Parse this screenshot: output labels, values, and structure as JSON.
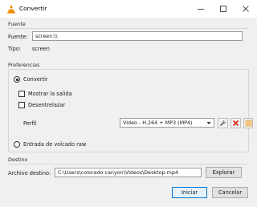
{
  "window": {
    "title": "Convertir",
    "app_icon": "vlc-cone-icon",
    "controls": [
      "minimize-icon",
      "maximize-icon",
      "close-icon"
    ]
  },
  "source": {
    "group_label": "Fuente",
    "field_label": "Fuente:",
    "field_value": "screen:\\\\",
    "type_label": "Tipo:",
    "type_value": "screen"
  },
  "preferences": {
    "group_label": "Preferencias",
    "convert_label": "Convertir",
    "convert_selected": true,
    "show_output_label": "Mostrar la salida",
    "show_output_checked": false,
    "deinterlace_label": "Desentrelazar",
    "deinterlace_checked": false,
    "profile_label": "Perfil",
    "profile_value": "Video - H.264 + MP3 (MP4)",
    "profile_buttons": [
      "wrench-icon",
      "delete-x-icon",
      "new-profile-icon"
    ],
    "dump_raw_label": "Entrada de volcado raw",
    "dump_raw_selected": false
  },
  "destination": {
    "group_label": "Destino",
    "file_label": "Archivo destino:",
    "file_value": "C:\\Users\\colorado canyon\\Videos\\Desktop.mp4",
    "browse_label": "Explorar"
  },
  "actions": {
    "start_label": "Iniciar",
    "cancel_label": "Cancelar"
  },
  "colors": {
    "accent": "#0078d7",
    "vlc_orange": "#f28c00",
    "delete_red": "#d9261c"
  }
}
